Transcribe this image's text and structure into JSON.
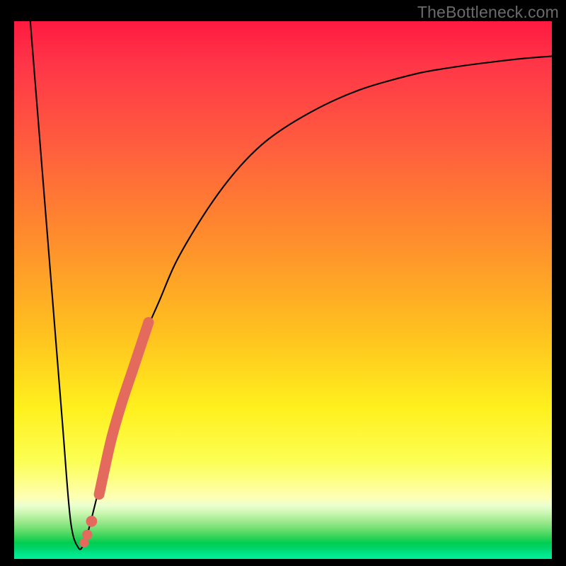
{
  "watermark": "TheBottleneck.com",
  "chart_data": {
    "type": "line",
    "title": "",
    "xlabel": "",
    "ylabel": "",
    "xlim": [
      0,
      100
    ],
    "ylim": [
      0,
      100
    ],
    "grid": false,
    "legend": false,
    "series": [
      {
        "name": "bottleneck-curve",
        "color": "#000000",
        "x": [
          3,
          5,
          7,
          9,
          10.5,
          12,
          13,
          14,
          16,
          18,
          21,
          24,
          27,
          30,
          34,
          38,
          42,
          46,
          50,
          55,
          60,
          65,
          70,
          76,
          82,
          88,
          94,
          100
        ],
        "y": [
          100,
          75,
          50,
          25,
          7,
          2,
          3,
          6,
          14,
          22,
          32,
          41,
          48,
          55,
          62,
          68,
          73,
          77,
          80,
          83,
          85.5,
          87.5,
          89,
          90.5,
          91.5,
          92.3,
          93,
          93.5
        ]
      }
    ],
    "highlight_segment": {
      "name": "highlighted-range",
      "color": "#e46a5e",
      "x": [
        13,
        13.6,
        14.4,
        15.8,
        18,
        20,
        22,
        24,
        25
      ],
      "y": [
        3,
        4.5,
        7,
        12,
        22,
        29,
        35,
        41,
        44
      ]
    }
  }
}
